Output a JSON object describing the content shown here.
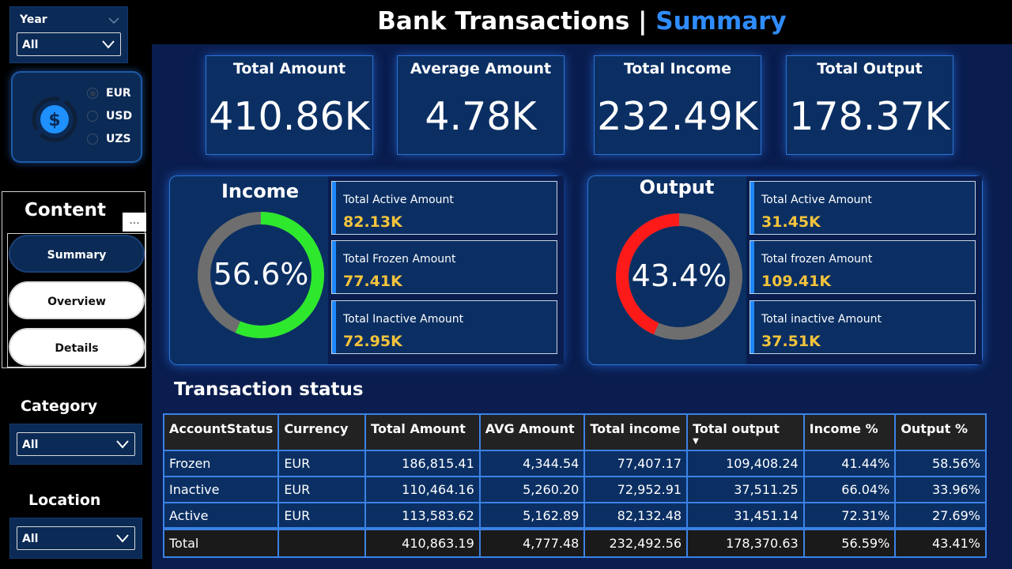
{
  "header": {
    "title_main": "Bank Transactions | ",
    "title_accent": "Summary"
  },
  "filters": {
    "year": {
      "label": "Year",
      "value": "All"
    },
    "category": {
      "label": "Category",
      "value": "All"
    },
    "location": {
      "label": "Location",
      "value": "All"
    }
  },
  "currency": {
    "icon": "dollar-coin-icon",
    "options": [
      "EUR",
      "USD",
      "UZS"
    ],
    "selected": "EUR"
  },
  "content_nav": {
    "title": "Content",
    "more": "...",
    "items": [
      {
        "label": "Summary",
        "active": true
      },
      {
        "label": "Overview",
        "active": false
      },
      {
        "label": "Details",
        "active": false
      }
    ]
  },
  "kpis": [
    {
      "label": "Total Amount",
      "value": "410.86K"
    },
    {
      "label": "Average Amount",
      "value": "4.78K"
    },
    {
      "label": "Total Income",
      "value": "232.49K"
    },
    {
      "label": "Total Output",
      "value": "178.37K"
    }
  ],
  "income_panel": {
    "title": "Income",
    "percent_label": "56.6%",
    "percent": 0.566,
    "ring_color": "#2ee82e",
    "rest_color": "#6e6e6e",
    "cards": [
      {
        "label": "Total Active Amount",
        "value": "82.13K"
      },
      {
        "label": "Total Frozen Amount",
        "value": "77.41K"
      },
      {
        "label": "Total Inactive Amount",
        "value": "72.95K"
      }
    ]
  },
  "output_panel": {
    "title": "Output",
    "percent_label": "43.4%",
    "percent": 0.434,
    "ring_color": "#ff1a1a",
    "rest_color": "#6e6e6e",
    "cards": [
      {
        "label": "Total Active Amount",
        "value": "31.45K"
      },
      {
        "label": "Total frozen Amount",
        "value": "109.41K"
      },
      {
        "label": "Total inactive Amount",
        "value": "37.51K"
      }
    ]
  },
  "status_table": {
    "title": "Transaction status",
    "columns": [
      "AccountStatus",
      "Currency",
      "Total Amount",
      "AVG Amount",
      "Total income",
      "Total output",
      "Income %",
      "Output %"
    ],
    "sorted_column": "Total output",
    "rows": [
      [
        "Frozen",
        "EUR",
        "186,815.41",
        "4,344.54",
        "77,407.17",
        "109,408.24",
        "41.44%",
        "58.56%"
      ],
      [
        "Inactive",
        "EUR",
        "110,464.16",
        "5,260.20",
        "72,952.91",
        "37,511.25",
        "66.04%",
        "33.96%"
      ],
      [
        "Active",
        "EUR",
        "113,583.62",
        "5,162.89",
        "82,132.48",
        "31,451.14",
        "72.31%",
        "27.69%"
      ]
    ],
    "total": [
      "Total",
      "",
      "410,863.19",
      "4,777.48",
      "232,492.56",
      "178,370.63",
      "56.59%",
      "43.41%"
    ]
  },
  "colors": {
    "accent": "#2f8cff",
    "card_bg": "#0b2f63",
    "page_bg": "#0a1d4e",
    "value_gold": "#f3c33c"
  }
}
